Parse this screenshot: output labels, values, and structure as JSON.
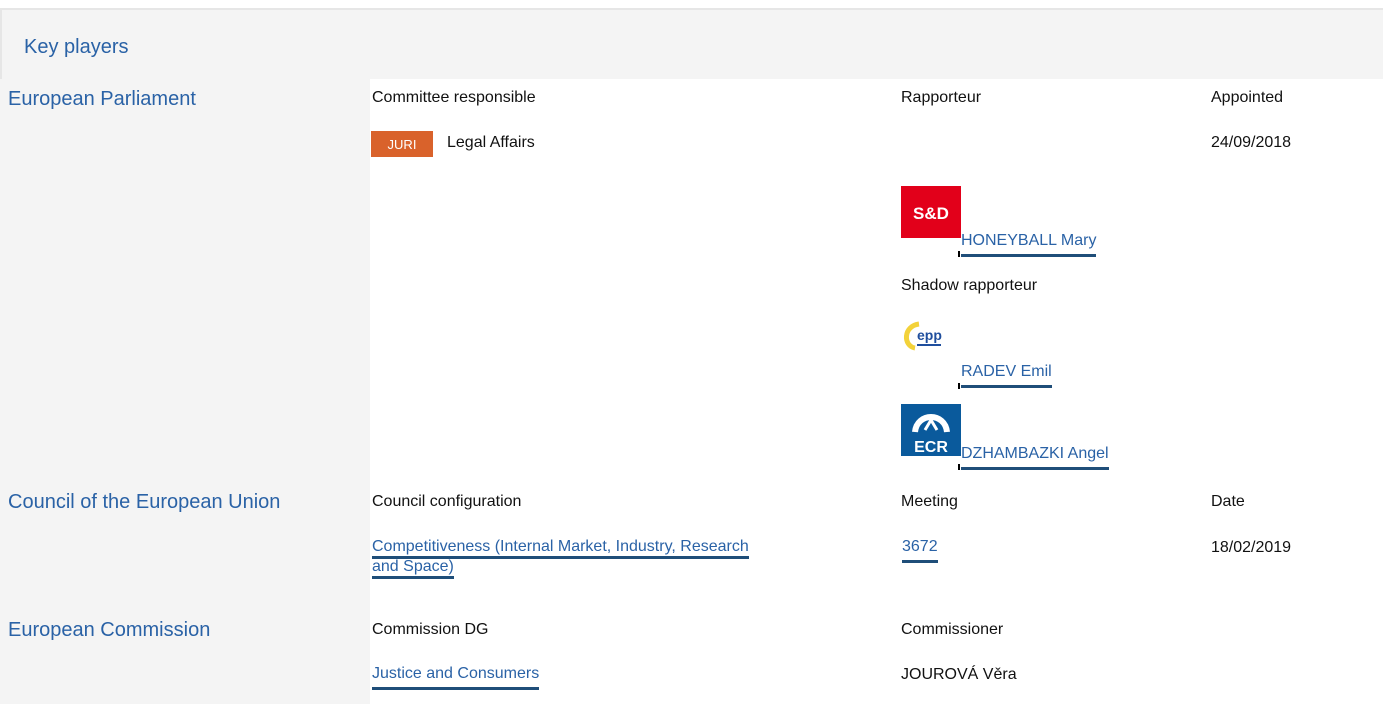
{
  "section": {
    "title": "Key players"
  },
  "ep": {
    "institution": "European Parliament",
    "col_committee": "Committee responsible",
    "col_rapporteur": "Rapporteur",
    "col_appointed": "Appointed",
    "committee_code": "JURI",
    "committee_name": "Legal Affairs",
    "appointed_date": "24/09/2018",
    "rapporteur": {
      "group_logo": "S&D",
      "name": "HONEYBALL Mary"
    },
    "shadow_label": "Shadow rapporteur",
    "shadows": [
      {
        "group_logo": "epp",
        "name": "RADEV Emil"
      },
      {
        "group_logo": "ECR",
        "name": "DZHAMBAZKI Angel"
      }
    ]
  },
  "council": {
    "institution": "Council of the European Union",
    "col_configuration": "Council configuration",
    "col_meeting": "Meeting",
    "col_date": "Date",
    "configuration_line1": "Competitiveness (Internal Market, Industry, Research",
    "configuration_line2": "and Space)",
    "meeting": "3672",
    "date": "18/02/2019"
  },
  "commission": {
    "institution": "European Commission",
    "col_dg": "Commission DG",
    "col_commissioner": "Commissioner",
    "dg": "Justice and Consumers",
    "commissioner": "JOUROVÁ Věra"
  },
  "colors": {
    "link": "#2a62a6",
    "underline": "#1f4e79",
    "badge": "#d9622b",
    "sd": "#e2001a",
    "ecr": "#0a5a9c"
  }
}
